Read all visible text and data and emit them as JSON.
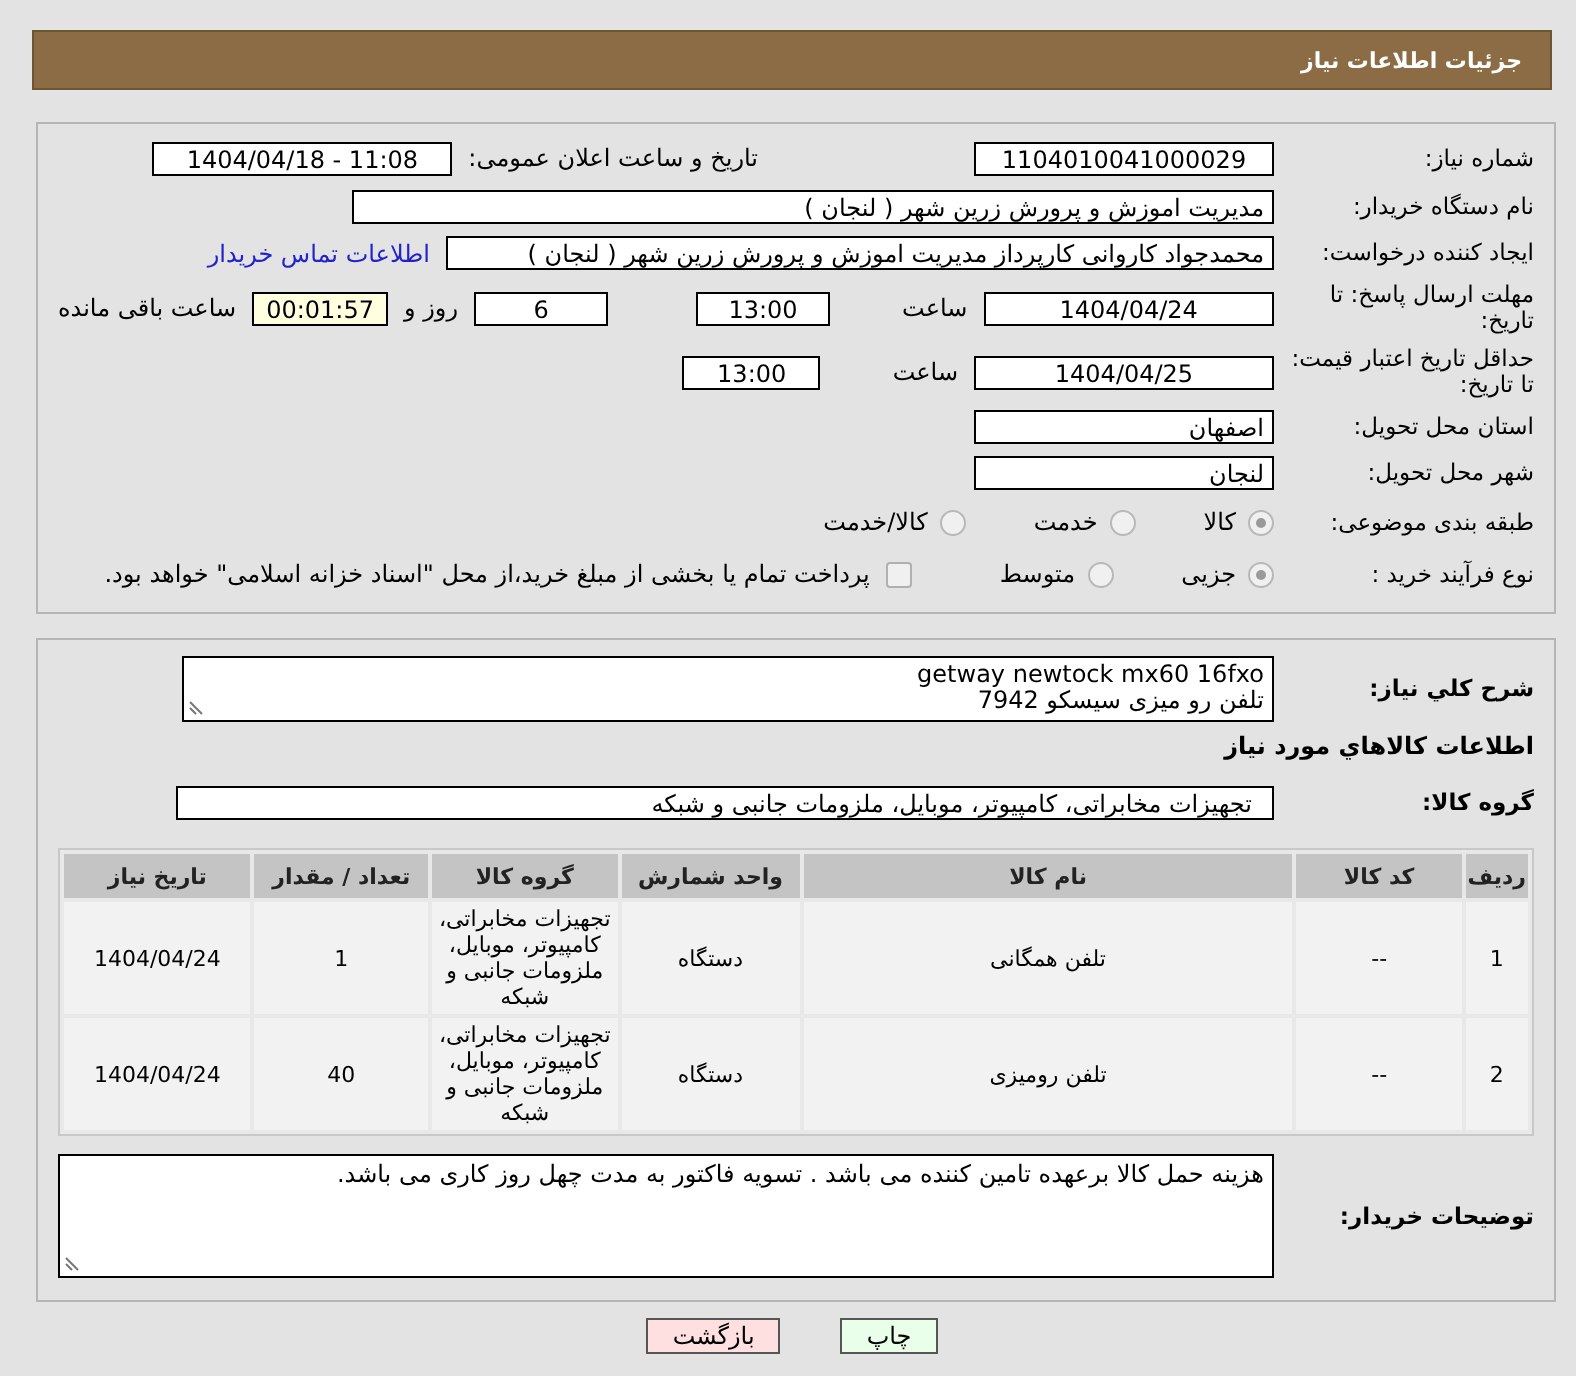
{
  "header": {
    "title": "جزئیات اطلاعات نیاز"
  },
  "need_number": {
    "label": "شماره نیاز:",
    "value": "1104010041000029"
  },
  "announce": {
    "label": "تاریخ و ساعت اعلان عمومی:",
    "value": "1404/04/18 - 11:08"
  },
  "buyer_org": {
    "label": "نام دستگاه خریدار:",
    "value": "مدیریت اموزش و پرورش زرین شهر ( لنجان )"
  },
  "requester": {
    "label": "ایجاد کننده درخواست:",
    "value": "محمدجواد کاروانی کارپرداز مدیریت اموزش و پرورش زرین شهر ( لنجان )",
    "link": "اطلاعات تماس خریدار"
  },
  "reply_deadline": {
    "label": "مهلت ارسال پاسخ: تا تاریخ:",
    "date": "1404/04/24",
    "time_label": "ساعت",
    "time": "13:00",
    "days": "6",
    "days_label": "روز و",
    "remaining": "00:01:57",
    "remaining_label": "ساعت باقی مانده"
  },
  "price_validity": {
    "label": "حداقل تاریخ اعتبار قیمت: تا تاریخ:",
    "date": "1404/04/25",
    "time_label": "ساعت",
    "time": "13:00"
  },
  "province": {
    "label": "استان محل تحویل:",
    "value": "اصفهان"
  },
  "city": {
    "label": "شهر محل تحویل:",
    "value": "لنجان"
  },
  "category": {
    "label": "طبقه بندی موضوعی:",
    "options": [
      {
        "label": "کالا",
        "selected": true
      },
      {
        "label": "خدمت",
        "selected": false
      },
      {
        "label": "کالا/خدمت",
        "selected": false
      }
    ]
  },
  "process": {
    "label": "نوع فرآیند خرید :",
    "options": [
      {
        "label": "جزیی",
        "selected": true
      },
      {
        "label": "متوسط",
        "selected": false
      }
    ],
    "payment": {
      "checked": false,
      "label": "پرداخت تمام یا بخشی از مبلغ خرید،از محل \"اسناد خزانه اسلامی\" خواهد بود."
    }
  },
  "description": {
    "label": "شرح کلي نياز:",
    "lines": [
      "getway newtock mx60 16fxo",
      "تلفن رو میزی سیسکو 7942"
    ]
  },
  "items": {
    "heading": "اطلاعات کالاهاي مورد نياز",
    "group_label": "گروه کالا:",
    "group": "تجهیزات مخابراتی، کامپیوتر، موبایل، ملزومات جانبی و شبکه",
    "columns": [
      "ردیف",
      "کد کالا",
      "نام کالا",
      "واحد شمارش",
      "گروه کالا",
      "تعداد / مقدار",
      "تاریخ نیاز"
    ],
    "rows": [
      [
        "1",
        "--",
        "تلفن همگانی",
        "دستگاه",
        "تجهیزات مخابراتی، کامپیوتر، موبایل، ملزومات جانبی و شبکه",
        "1",
        "1404/04/24"
      ],
      [
        "2",
        "--",
        "تلفن رومیزی",
        "دستگاه",
        "تجهیزات مخابراتی، کامپیوتر، موبایل، ملزومات جانبی و شبکه",
        "40",
        "1404/04/24"
      ]
    ]
  },
  "notes": {
    "label": "توضیحات خریدار:",
    "value": "هزینه حمل کالا برعهده تامین کننده می باشد . تسویه فاکتور به مدت چهل روز کاری می باشد."
  },
  "buttons": [
    {
      "label": "چاپ",
      "kind": "print"
    },
    {
      "label": "بازگشت",
      "kind": "back"
    }
  ]
}
